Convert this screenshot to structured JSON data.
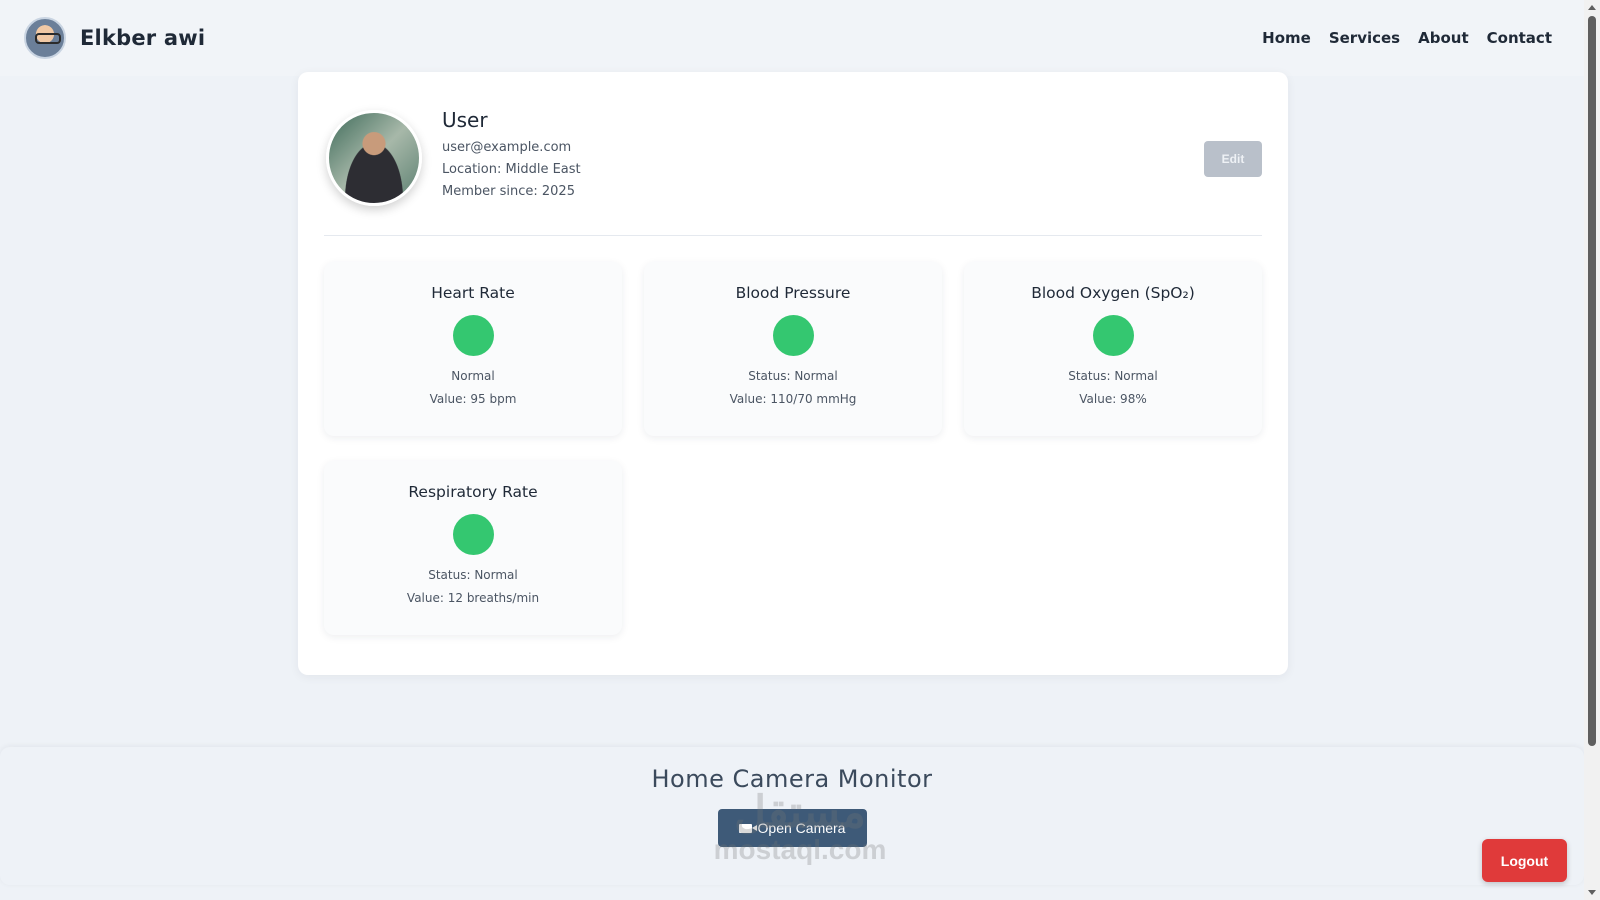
{
  "brand": {
    "name": "Elkber awi",
    "logo_icon": "elderly-man-cartoon-logo"
  },
  "nav": {
    "items": [
      "Home",
      "Services",
      "About",
      "Contact"
    ]
  },
  "profile": {
    "name": "User",
    "email": "user@example.com",
    "location": "Location: Middle East",
    "member_since": "Member since: 2025",
    "edit_label": "Edit"
  },
  "vitals": [
    {
      "title": "Heart Rate",
      "status": "Normal",
      "value": "Value: 95 bpm",
      "indicator_color": "#34c770"
    },
    {
      "title": "Blood Pressure",
      "status": "Status: Normal",
      "value": "Value: 110/70 mmHg",
      "indicator_color": "#34c770"
    },
    {
      "title": "Blood Oxygen (SpO₂)",
      "status": "Status: Normal",
      "value": "Value: 98%",
      "indicator_color": "#34c770"
    },
    {
      "title": "Respiratory Rate",
      "status": "Status: Normal",
      "value": "Value: 12 breaths/min",
      "indicator_color": "#34c770"
    }
  ],
  "camera": {
    "title": "Home Camera Monitor",
    "button_label": "Open Camera",
    "button_icon": "video-camera-icon"
  },
  "watermark": {
    "arabic": "مستقل",
    "latin": "mostaql.com"
  },
  "logout_label": "Logout",
  "colors": {
    "accent": "#3e5a78",
    "danger": "#e03a3a",
    "status_normal": "#34c770"
  }
}
